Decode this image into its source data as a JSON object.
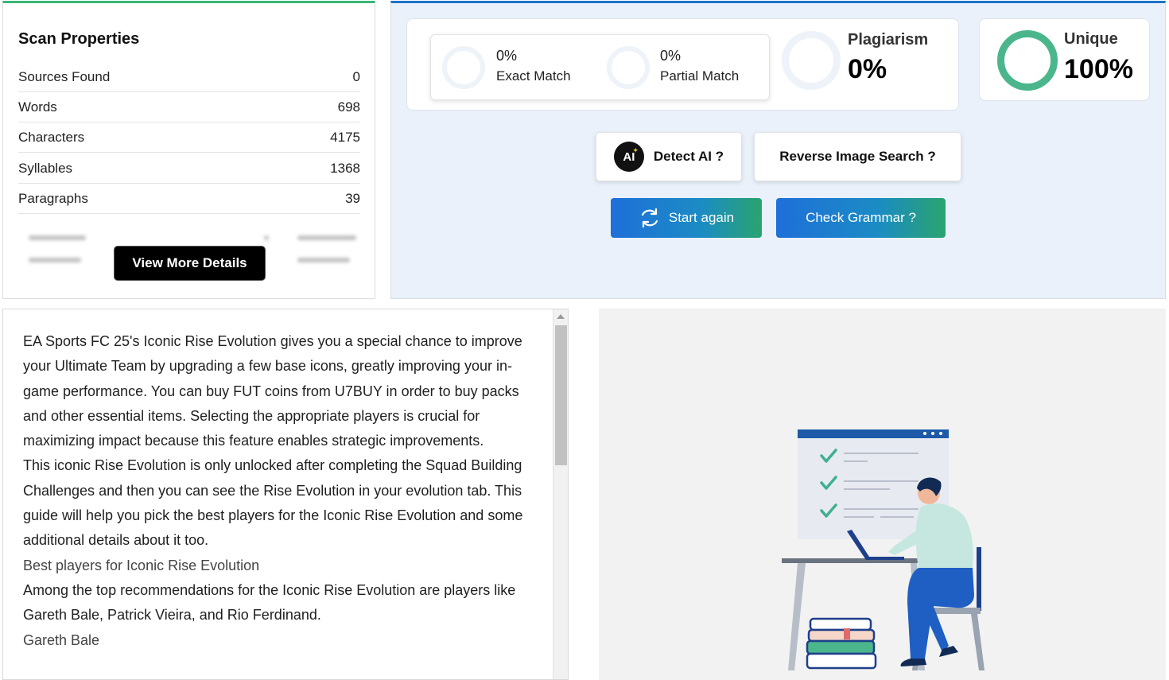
{
  "scan": {
    "title": "Scan Properties",
    "rows": [
      {
        "label": "Sources Found",
        "value": "0"
      },
      {
        "label": "Words",
        "value": "698"
      },
      {
        "label": "Characters",
        "value": "4175"
      },
      {
        "label": "Syllables",
        "value": "1368"
      },
      {
        "label": "Paragraphs",
        "value": "39"
      }
    ],
    "view_more_label": "View More Details",
    "accent_color": "#39b777"
  },
  "results": {
    "exact": {
      "pct": "0%",
      "label": "Exact Match"
    },
    "partial": {
      "pct": "0%",
      "label": "Partial Match"
    },
    "plagiarism": {
      "label": "Plagiarism",
      "value": "0%"
    },
    "unique": {
      "label": "Unique",
      "value": "100%",
      "fraction": 1.0,
      "color": "#4bb68c"
    },
    "accent_color": "#1e73c8"
  },
  "actions": {
    "detect_ai_badge": "AI",
    "detect_ai_label": "Detect AI ?",
    "reverse_image_label": "Reverse Image Search ?",
    "start_again_label": "Start again",
    "check_grammar_label": "Check Grammar ?"
  },
  "text": {
    "paragraphs": [
      {
        "type": "body",
        "content": "EA Sports FC 25's Iconic Rise Evolution gives you a special chance to improve your Ultimate Team by upgrading a few base icons, greatly improving your in-game performance. You can buy FUT coins from U7BUY in order to buy packs and other essential items. Selecting the appropriate players is crucial for maximizing impact because this feature enables strategic improvements."
      },
      {
        "type": "body",
        "content": "This iconic Rise Evolution is only unlocked after completing the Squad Building Challenges and then you can see the Rise Evolution in your evolution tab. This guide will help you pick the best players for the Iconic Rise Evolution and some additional details about it too."
      },
      {
        "type": "heading",
        "content": "Best players for Iconic Rise Evolution"
      },
      {
        "type": "body",
        "content": "Among the top recommendations for the Iconic Rise Evolution are players like Gareth Bale, Patrick Vieira, and Rio Ferdinand."
      },
      {
        "type": "heading",
        "content": "Gareth Bale"
      }
    ]
  }
}
